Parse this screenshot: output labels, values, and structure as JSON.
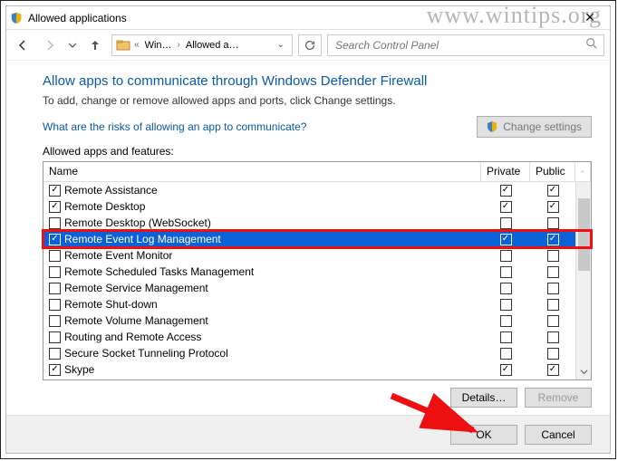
{
  "window_title": "Allowed applications",
  "watermark": "www.wintips.org",
  "breadcrumb": {
    "level1": "Win…",
    "level2": "Allowed a…"
  },
  "search_placeholder": "Search Control Panel",
  "heading": "Allow apps to communicate through Windows Defender Firewall",
  "subtext": "To add, change or remove allowed apps and ports, click Change settings.",
  "risk_link": "What are the risks of allowing an app to communicate?",
  "change_settings_label": "Change settings",
  "list_label": "Allowed apps and features:",
  "columns": {
    "name": "Name",
    "private": "Private",
    "public": "Public"
  },
  "rows": [
    {
      "name": "Remote Assistance",
      "enabled": true,
      "private": true,
      "public": true,
      "selected": false
    },
    {
      "name": "Remote Desktop",
      "enabled": true,
      "private": true,
      "public": true,
      "selected": false
    },
    {
      "name": "Remote Desktop (WebSocket)",
      "enabled": false,
      "private": false,
      "public": false,
      "selected": false
    },
    {
      "name": "Remote Event Log Management",
      "enabled": true,
      "private": true,
      "public": true,
      "selected": true
    },
    {
      "name": "Remote Event Monitor",
      "enabled": false,
      "private": false,
      "public": false,
      "selected": false
    },
    {
      "name": "Remote Scheduled Tasks Management",
      "enabled": false,
      "private": false,
      "public": false,
      "selected": false
    },
    {
      "name": "Remote Service Management",
      "enabled": false,
      "private": false,
      "public": false,
      "selected": false
    },
    {
      "name": "Remote Shut-down",
      "enabled": false,
      "private": false,
      "public": false,
      "selected": false
    },
    {
      "name": "Remote Volume Management",
      "enabled": false,
      "private": false,
      "public": false,
      "selected": false
    },
    {
      "name": "Routing and Remote Access",
      "enabled": false,
      "private": false,
      "public": false,
      "selected": false
    },
    {
      "name": "Secure Socket Tunneling Protocol",
      "enabled": false,
      "private": false,
      "public": false,
      "selected": false
    },
    {
      "name": "Skype",
      "enabled": true,
      "private": true,
      "public": true,
      "selected": false
    }
  ],
  "buttons": {
    "details": "Details…",
    "remove": "Remove",
    "ok": "OK",
    "cancel": "Cancel"
  }
}
